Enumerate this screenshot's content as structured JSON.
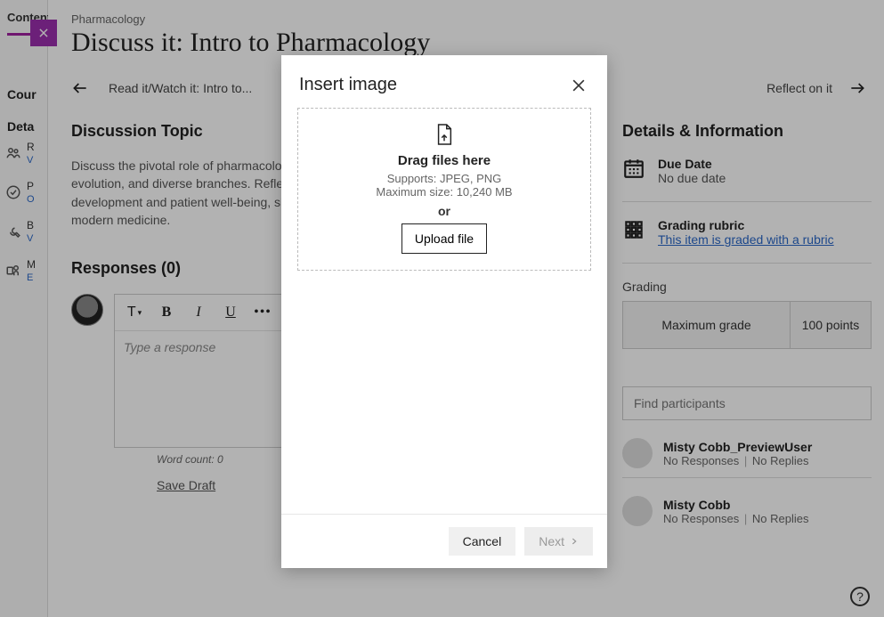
{
  "rail": {
    "tab": "Content",
    "section1": "Cour",
    "section2": "Deta",
    "items": [
      {
        "letter": "R",
        "sub": "V"
      },
      {
        "letter": "P",
        "sub": "O"
      },
      {
        "letter": "B",
        "sub": "V"
      },
      {
        "letter": "M",
        "sub": "E"
      }
    ]
  },
  "page": {
    "crumb": "Pharmacology",
    "title": "Discuss it: Intro to Pharmacology",
    "prev_label": "Read it/Watch it: Intro to...",
    "next_label": "Reflect on it",
    "topic_heading": "Discussion Topic",
    "topic_text": "Discuss the pivotal role of pharmacology in healthcare, exploring its definition, historical evolution, and diverse branches. Reflect on how pharmacological principles impact drug development and patient well-being, sharing insights on the practical applications in modern medicine.",
    "responses_heading": "Responses (0)",
    "toolbar": {
      "text": "T",
      "bold": "B",
      "italic": "I",
      "underline": "U",
      "more": "•••"
    },
    "response_placeholder": "Type a response",
    "word_count": "Word count: 0",
    "save_draft": "Save Draft"
  },
  "details": {
    "heading": "Details & Information",
    "due_label": "Due Date",
    "due_value": "No due date",
    "rubric_label": "Grading rubric",
    "rubric_link": "This item is graded with a rubric",
    "grading_label": "Grading",
    "max_grade_label": "Maximum grade",
    "max_grade_value": "100 points",
    "find_placeholder": "Find participants",
    "participants": [
      {
        "name": "Misty Cobb_PreviewUser",
        "responses": "No Responses",
        "replies": "No Replies"
      },
      {
        "name": "Misty Cobb",
        "responses": "No Responses",
        "replies": "No Replies"
      }
    ]
  },
  "modal": {
    "title": "Insert image",
    "dz_title": "Drag files here",
    "dz_supports": "Supports: JPEG, PNG",
    "dz_max": "Maximum size: 10,240 MB",
    "dz_or": "or",
    "upload": "Upload file",
    "cancel": "Cancel",
    "next": "Next"
  },
  "sep": "|"
}
